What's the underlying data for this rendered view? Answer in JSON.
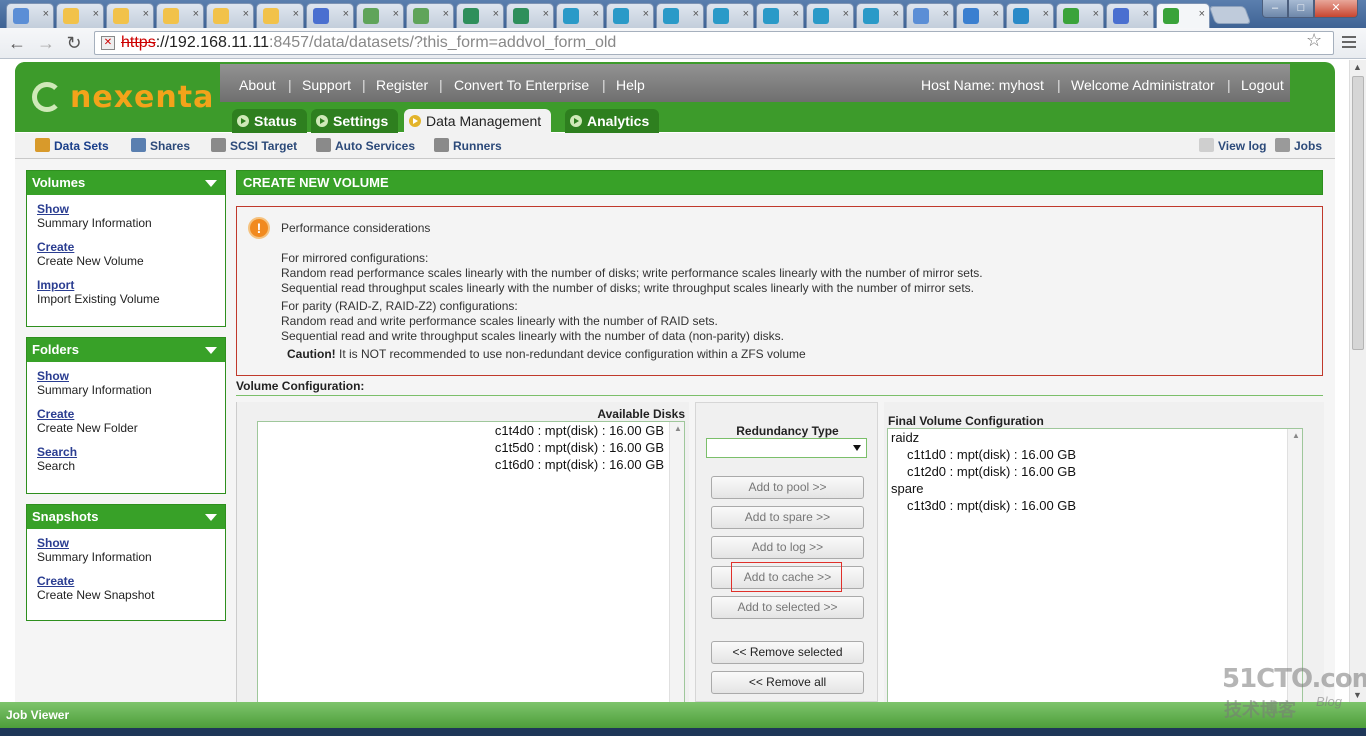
{
  "browser": {
    "tab_favicon_colors": [
      "#5b8ed6",
      "#f2c24a",
      "#f2c24a",
      "#f2c24a",
      "#f2c24a",
      "#f2c24a",
      "#4a6fd0",
      "#5fa45a",
      "#5fa45a",
      "#2e8f5b",
      "#2e8f5b",
      "#2a9ac8",
      "#2a9ac8",
      "#2a9ac8",
      "#2a9ac8",
      "#2a9ac8",
      "#2a9ac8",
      "#2a9ac8",
      "#5b8ed6",
      "#3a7fd0",
      "#2a8ac8",
      "#3aa33a",
      "#4a6fd0",
      "#3aa33a"
    ],
    "close_glyph": "×",
    "address": {
      "scheme": "https",
      "host": "://192.168.11.11",
      "rest_dim": ":8457",
      "path": "/data/datasets/?this_form=addvol_form_old"
    },
    "window_buttons": {
      "min": "–",
      "max": "□",
      "close": "✕"
    }
  },
  "header": {
    "logo_text": "nexenta",
    "top_links": [
      "About",
      "Support",
      "Register",
      "Convert To Enterprise",
      "Help"
    ],
    "host_name": "Host Name: myhost",
    "welcome": "Welcome Administrator",
    "logout": "Logout",
    "separator": "|",
    "main_tabs": [
      {
        "label": "Status",
        "active": false
      },
      {
        "label": "Settings",
        "active": false
      },
      {
        "label": "Data Management",
        "active": true
      },
      {
        "label": "Analytics",
        "active": false
      }
    ]
  },
  "subnav": {
    "items": [
      "Data Sets",
      "Shares",
      "SCSI Target",
      "Auto Services",
      "Runners"
    ],
    "right_items": [
      "View log",
      "Jobs"
    ],
    "icon_colors": [
      "#d89a2b",
      "#5a7fb0",
      "#8a8a8a",
      "#8a8a8a",
      "#8a8a8a",
      "#cfcfcf",
      "#9a9a9a"
    ]
  },
  "sidebar": {
    "panels": [
      {
        "title": "Volumes",
        "entries": [
          {
            "link": "Show",
            "desc": "Summary Information"
          },
          {
            "link": "Create",
            "desc": "Create New Volume"
          },
          {
            "link": "Import",
            "desc": "Import Existing Volume"
          }
        ]
      },
      {
        "title": "Folders",
        "entries": [
          {
            "link": "Show",
            "desc": "Summary Information"
          },
          {
            "link": "Create",
            "desc": "Create New Folder"
          },
          {
            "link": "Search",
            "desc": "Search"
          }
        ]
      },
      {
        "title": "Snapshots",
        "entries": [
          {
            "link": "Show",
            "desc": "Summary Information"
          },
          {
            "link": "Create",
            "desc": "Create New Snapshot"
          }
        ]
      }
    ]
  },
  "main": {
    "title": "CREATE NEW VOLUME",
    "perf": {
      "heading": "Performance considerations",
      "mirror_title": "For mirrored configurations:",
      "mirror_1": "Random read performance scales linearly with the number of disks; write performance scales linearly with the number of mirror sets.",
      "mirror_2": "Sequential read throughput scales linearly with the number of disks; write throughput scales linearly with the number of mirror sets.",
      "parity_title": "For parity (RAID-Z, RAID-Z2) configurations:",
      "parity_1": "Random read and write performance scales linearly with the number of RAID sets.",
      "parity_2": "Sequential read and write throughput scales linearly with the number of data (non-parity) disks.",
      "caution_label": "Caution!",
      "caution_text": " It is NOT recommended to use non-redundant device configuration within a ZFS volume"
    },
    "volume_config_label": "Volume Configuration:",
    "available_disks_label": "Available Disks",
    "available_disks": [
      "c1t4d0 : mpt(disk) : 16.00 GB",
      "c1t5d0 : mpt(disk) : 16.00 GB",
      "c1t6d0 : mpt(disk) : 16.00 GB"
    ],
    "redundancy_label": "Redundancy Type",
    "redundancy_value": "",
    "buttons": [
      {
        "label": "Add to pool >>",
        "enabled": false
      },
      {
        "label": "Add to spare >>",
        "enabled": false
      },
      {
        "label": "Add to log >>",
        "enabled": false
      },
      {
        "label": "Add to cache >>",
        "enabled": false
      },
      {
        "label": "Add to selected >>",
        "enabled": false
      },
      {
        "label": "<< Remove selected",
        "enabled": true
      },
      {
        "label": "<< Remove all",
        "enabled": true
      }
    ],
    "final_label": "Final Volume Configuration",
    "final_config": [
      {
        "text": "raidz",
        "indent": false
      },
      {
        "text": "c1t1d0 : mpt(disk) : 16.00 GB",
        "indent": true
      },
      {
        "text": "c1t2d0 : mpt(disk) : 16.00 GB",
        "indent": true
      },
      {
        "text": "spare",
        "indent": false
      },
      {
        "text": "c1t3d0 : mpt(disk) : 16.00 GB",
        "indent": true
      }
    ]
  },
  "job_viewer": "Job Viewer",
  "watermark": {
    "line1": "51CTO.com",
    "line2": "技术博客",
    "line3": "Blog"
  }
}
